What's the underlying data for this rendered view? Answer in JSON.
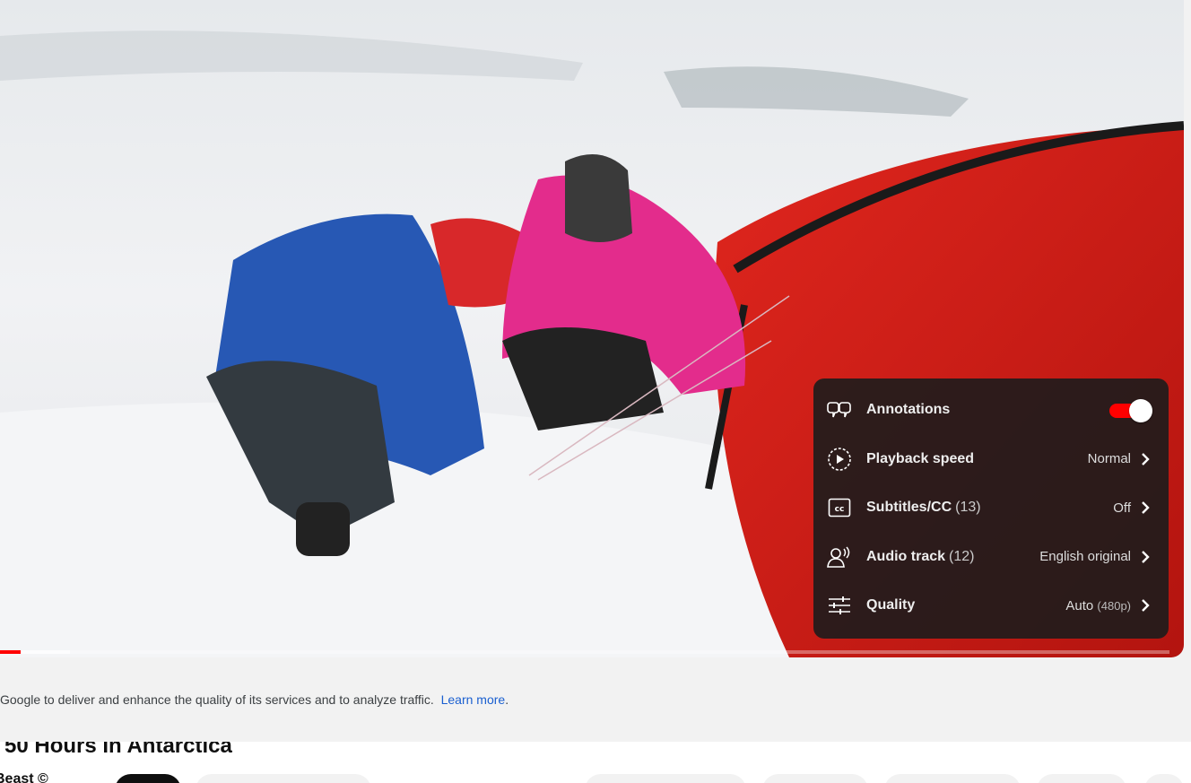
{
  "settings_menu": {
    "items": [
      {
        "icon": "annotations-icon",
        "label": "Annotations",
        "type": "toggle",
        "state": "on"
      },
      {
        "icon": "playback-speed-icon",
        "label": "Playback speed",
        "value": "Normal"
      },
      {
        "icon": "subtitles-icon",
        "label": "Subtitles/CC",
        "count": "(13)",
        "value": "Off"
      },
      {
        "icon": "audio-track-icon",
        "label": "Audio track",
        "count": "(12)",
        "value": "English original"
      },
      {
        "icon": "quality-icon",
        "label": "Quality",
        "value": "Auto",
        "value_detail": "(480p)"
      }
    ]
  },
  "progress": {
    "played_fraction": 0.018,
    "buffered_fraction": 0.06
  },
  "consent": {
    "text": "Google to deliver and enhance the quality of its services and to analyze traffic.",
    "link": "Learn more",
    "suffix": "."
  },
  "video": {
    "title": "50 Hours In Antarctica",
    "channel": "Beast ©"
  },
  "colors": {
    "accent": "#ff0000",
    "menu_bg": "#1c1c1c",
    "link": "#1a5fd0"
  }
}
